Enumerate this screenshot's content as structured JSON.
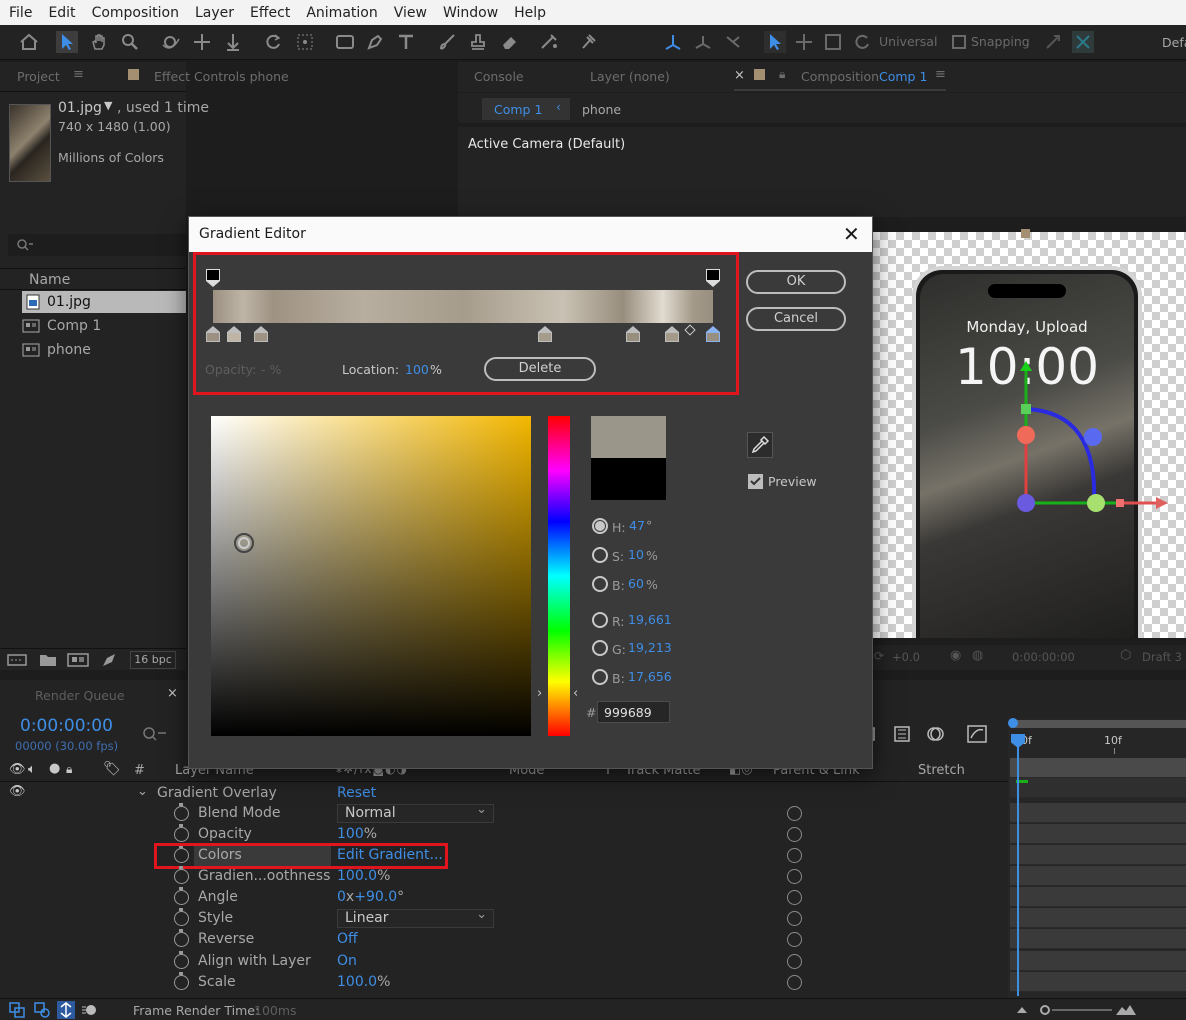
{
  "menu": [
    "File",
    "Edit",
    "Composition",
    "Layer",
    "Effect",
    "Animation",
    "View",
    "Window",
    "Help"
  ],
  "toolbar": {
    "universal": "Universal",
    "snapping": "Snapping",
    "default_ws": "Defa"
  },
  "project_panel": {
    "tab": "Project",
    "effect_tab": "Effect Controls phone",
    "file_name": "01.jpg",
    "used": ", used 1 time",
    "dimensions": "740 x 1480 (1.00)",
    "colors": "Millions of Colors",
    "search_placeholder": "",
    "column_name": "Name",
    "items": [
      "01.jpg",
      "Comp 1",
      "phone"
    ],
    "bpc": "16 bpc"
  },
  "comp_panel": {
    "console_tab": "Console",
    "layer_tab": "Layer (none)",
    "comp_tab_label": "Composition",
    "comp_tab_name": "Comp 1",
    "breadcrumb_comp": "Comp 1",
    "breadcrumb_layer": "phone",
    "camera": "Active Camera (Default)",
    "phone_date": "Monday, Upload",
    "phone_time": "10:00",
    "zoom_offset": "+0.0",
    "timecode_small": "0:00:00:00",
    "draft": "Draft 3"
  },
  "dialog": {
    "title": "Gradient Editor",
    "ok": "OK",
    "cancel": "Cancel",
    "opacity_label": "Opacity:",
    "opacity_value": "- %",
    "location_label": "Location:",
    "location_value": "100",
    "location_unit": "%",
    "delete": "Delete",
    "preview": "Preview",
    "h_label": "H:",
    "h_value": "47",
    "h_unit": "°",
    "s_label": "S:",
    "s_value": "10",
    "s_unit": "%",
    "b_label": "B:",
    "b_value": "60",
    "b_unit": "%",
    "r_label": "R:",
    "r_value": "19,661",
    "g_label": "G:",
    "g_value": "19,213",
    "b2_label": "B:",
    "b2_value": "17,656",
    "hash": "#",
    "hex": "999689",
    "new_color": "#9a9689",
    "old_color": "#000000"
  },
  "timeline": {
    "render_queue": "Render Queue",
    "timecode": "0:00:00:00",
    "frames": "00000 (30.00 fps)",
    "col_hash": "#",
    "col_layer": "Layer Name",
    "col_mode": "Mode",
    "col_t": "T",
    "col_track": "Track Matte",
    "col_parent": "Parent & Link",
    "col_stretch": "Stretch",
    "ruler_0": "0f",
    "ruler_10": "10f",
    "group": "Gradient Overlay",
    "group_reset": "Reset",
    "props": [
      {
        "name": "Blend Mode",
        "value": "Normal"
      },
      {
        "name": "Opacity",
        "value": "100",
        "unit": "%"
      },
      {
        "name": "Colors",
        "value": "Edit Gradient..."
      },
      {
        "name": "Gradien...oothness",
        "value": "100.0",
        "unit": "%"
      },
      {
        "name": "Angle",
        "value": "0",
        "unit": "x",
        "value2": "+90.0",
        "unit2": "°"
      },
      {
        "name": "Style",
        "value": "Linear"
      },
      {
        "name": "Reverse",
        "value": "Off"
      },
      {
        "name": "Align with Layer",
        "value": "On"
      },
      {
        "name": "Scale",
        "value": "100.0",
        "unit": "%"
      }
    ],
    "frame_render_label": "Frame Render Time:",
    "frame_render_value": "100ms"
  }
}
